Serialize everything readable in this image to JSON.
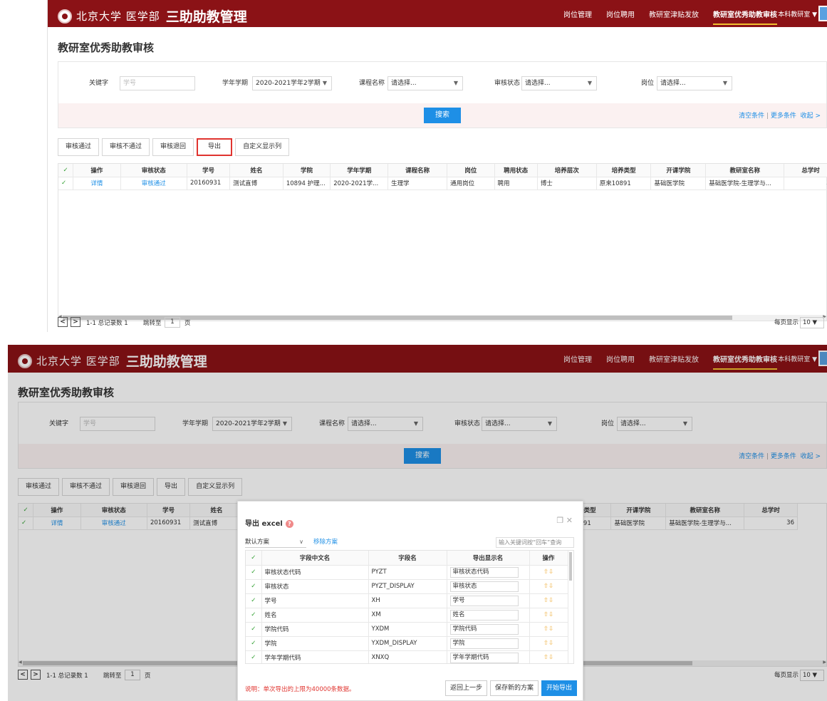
{
  "header": {
    "logo_text": "北京大学 医学部",
    "system_title": "三助助教管理",
    "nav": [
      "岗位管理",
      "岗位聘用",
      "教研室津贴发放",
      "教研室优秀助教审核"
    ],
    "role": "本科教研室 ▼"
  },
  "page": {
    "title": "教研室优秀助教审核"
  },
  "filters": {
    "keyword_label": "关键字",
    "keyword_placeholder": "学号",
    "term_label": "学年学期",
    "term_value": "2020-2021学年2学期",
    "course_label": "课程名称",
    "course_value": "请选择...",
    "status_label": "审核状态",
    "status_value": "请选择...",
    "post_label": "岗位",
    "post_value": "请选择...",
    "search": "搜索",
    "clear": "清空条件",
    "more": "更多条件",
    "collapse": "收起 >"
  },
  "toolbar": [
    "审核通过",
    "审核不通过",
    "审核退回",
    "导出",
    "自定义显示列"
  ],
  "table": {
    "columns": [
      "操作",
      "审核状态",
      "学号",
      "姓名",
      "学院",
      "学年学期",
      "课程名称",
      "岗位",
      "聘用状态",
      "培养层次",
      "培养类型",
      "开课学院",
      "教研室名称",
      "总学时"
    ],
    "rows": [
      [
        "详情",
        "审核通过",
        "20160931",
        "测试直博",
        "10894 护理...",
        "2020-2021学...",
        "生理学",
        "通用岗位",
        "聘用",
        "博士",
        "原来10891",
        "基础医学院",
        "基础医学院-生理学与...",
        "36"
      ]
    ]
  },
  "pager": {
    "summary": "1-1 总记录数 1",
    "goto": "跳转至",
    "page": "1",
    "page_unit": "页",
    "per_page_label": "每页显示",
    "per_page": "10"
  },
  "modal": {
    "title": "导出 excel",
    "scheme": "默认方案",
    "remove": "移除方案",
    "search_placeholder": "输入关键词按“回车”查询",
    "columns": [
      "字段中文名",
      "字段名",
      "导出显示名",
      "操作"
    ],
    "rows": [
      [
        "审核状态代码",
        "PYZT",
        "审核状态代码"
      ],
      [
        "审核状态",
        "PYZT_DISPLAY",
        "审核状态"
      ],
      [
        "学号",
        "XH",
        "学号"
      ],
      [
        "姓名",
        "XM",
        "姓名"
      ],
      [
        "学院代码",
        "YXDM",
        "学院代码"
      ],
      [
        "学院",
        "YXDM_DISPLAY",
        "学院"
      ],
      [
        "学年学期代码",
        "XNXQ",
        "学年学期代码"
      ]
    ],
    "note": "说明：单次导出的上限为40000条数据。",
    "btn_back": "返回上一步",
    "btn_save": "保存新的方案",
    "btn_start": "开始导出"
  },
  "colors": {
    "header": "#8b1216",
    "primary": "#1e8fe6",
    "highlight": "#e0342f",
    "check": "#2e9e2e"
  }
}
